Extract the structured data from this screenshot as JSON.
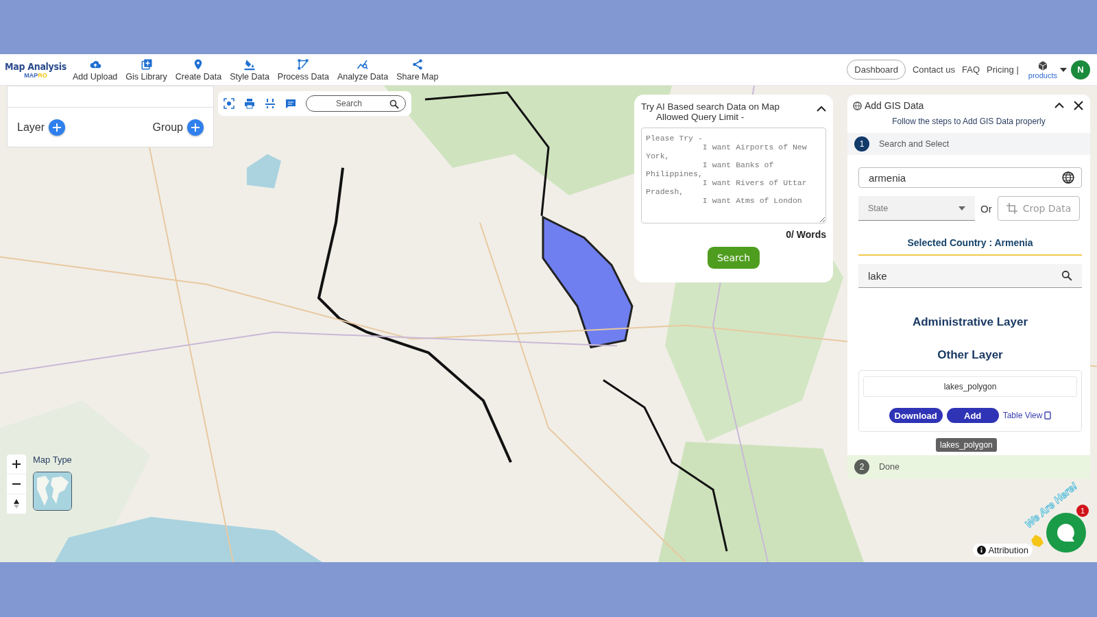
{
  "header": {
    "logo_title": "Map Analysis",
    "logo_sub": "MAP",
    "logo_accent": "RO",
    "nav": [
      {
        "label": "Add Upload"
      },
      {
        "label": "Gis Library"
      },
      {
        "label": "Create Data"
      },
      {
        "label": "Style Data"
      },
      {
        "label": "Process Data"
      },
      {
        "label": "Analyze Data"
      },
      {
        "label": "Share Map"
      }
    ],
    "dashboard": "Dashboard",
    "links": [
      "Contact us",
      "FAQ",
      "Pricing |"
    ],
    "products": "products",
    "avatar": "N"
  },
  "layer_panel": {
    "layer": "Layer",
    "group": "Group"
  },
  "map_toolbar": {
    "search_placeholder": "Search"
  },
  "ai_search": {
    "title": "Try AI Based search Data on Map",
    "subtitle": "Allowed Query Limit -",
    "placeholder": "Please Try -\n            I want Airports of New York,\n            I want Banks of Philippines,\n            I want Rivers of Uttar Pradesh,\n            I want Atms of London",
    "word_count": "0/ Words",
    "button": "Search"
  },
  "gis_panel": {
    "title": "Add GIS Data",
    "subtitle": "Follow the steps to Add GIS Data properly",
    "steps": [
      {
        "number": "1",
        "label": "Search and Select",
        "active": true
      },
      {
        "number": "2",
        "label": "Done",
        "active": false
      }
    ],
    "country": "armenia",
    "state_placeholder": "State",
    "or": "Or",
    "crop": "Crop Data",
    "selected_country": "Selected Country : Armenia",
    "search": "lake",
    "admin_heading": "Administrative Layer",
    "other_heading": "Other Layer",
    "result": {
      "name": "lakes_polygon",
      "download": "Download",
      "add": "Add",
      "table_view": "Table View",
      "tooltip": "lakes_polygon"
    }
  },
  "map_controls": {
    "map_type": "Map Type"
  },
  "chat": {
    "label": "We Are Here!",
    "badge": "1"
  },
  "attribution": "Attribution"
}
